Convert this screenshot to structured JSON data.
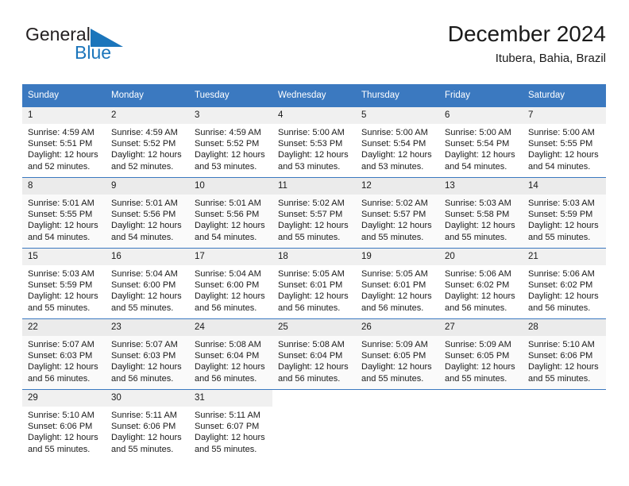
{
  "brand": {
    "name_part1": "General",
    "name_part2": "Blue",
    "logo_icon": "triangle-icon",
    "blue": "#1b75bb"
  },
  "header": {
    "title": "December 2024",
    "location": "Itubera, Bahia, Brazil",
    "header_bg": "#3b79c0"
  },
  "weekday_headers": [
    "Sunday",
    "Monday",
    "Tuesday",
    "Wednesday",
    "Thursday",
    "Friday",
    "Saturday"
  ],
  "labels": {
    "sunrise": "Sunrise:",
    "sunset": "Sunset:",
    "daylight": "Daylight:"
  },
  "weeks": [
    [
      {
        "day": "1",
        "sunrise": "Sunrise: 4:59 AM",
        "sunset": "Sunset: 5:51 PM",
        "daylight1": "Daylight: 12 hours",
        "daylight2": "and 52 minutes."
      },
      {
        "day": "2",
        "sunrise": "Sunrise: 4:59 AM",
        "sunset": "Sunset: 5:52 PM",
        "daylight1": "Daylight: 12 hours",
        "daylight2": "and 52 minutes."
      },
      {
        "day": "3",
        "sunrise": "Sunrise: 4:59 AM",
        "sunset": "Sunset: 5:52 PM",
        "daylight1": "Daylight: 12 hours",
        "daylight2": "and 53 minutes."
      },
      {
        "day": "4",
        "sunrise": "Sunrise: 5:00 AM",
        "sunset": "Sunset: 5:53 PM",
        "daylight1": "Daylight: 12 hours",
        "daylight2": "and 53 minutes."
      },
      {
        "day": "5",
        "sunrise": "Sunrise: 5:00 AM",
        "sunset": "Sunset: 5:54 PM",
        "daylight1": "Daylight: 12 hours",
        "daylight2": "and 53 minutes."
      },
      {
        "day": "6",
        "sunrise": "Sunrise: 5:00 AM",
        "sunset": "Sunset: 5:54 PM",
        "daylight1": "Daylight: 12 hours",
        "daylight2": "and 54 minutes."
      },
      {
        "day": "7",
        "sunrise": "Sunrise: 5:00 AM",
        "sunset": "Sunset: 5:55 PM",
        "daylight1": "Daylight: 12 hours",
        "daylight2": "and 54 minutes."
      }
    ],
    [
      {
        "day": "8",
        "sunrise": "Sunrise: 5:01 AM",
        "sunset": "Sunset: 5:55 PM",
        "daylight1": "Daylight: 12 hours",
        "daylight2": "and 54 minutes."
      },
      {
        "day": "9",
        "sunrise": "Sunrise: 5:01 AM",
        "sunset": "Sunset: 5:56 PM",
        "daylight1": "Daylight: 12 hours",
        "daylight2": "and 54 minutes."
      },
      {
        "day": "10",
        "sunrise": "Sunrise: 5:01 AM",
        "sunset": "Sunset: 5:56 PM",
        "daylight1": "Daylight: 12 hours",
        "daylight2": "and 54 minutes."
      },
      {
        "day": "11",
        "sunrise": "Sunrise: 5:02 AM",
        "sunset": "Sunset: 5:57 PM",
        "daylight1": "Daylight: 12 hours",
        "daylight2": "and 55 minutes."
      },
      {
        "day": "12",
        "sunrise": "Sunrise: 5:02 AM",
        "sunset": "Sunset: 5:57 PM",
        "daylight1": "Daylight: 12 hours",
        "daylight2": "and 55 minutes."
      },
      {
        "day": "13",
        "sunrise": "Sunrise: 5:03 AM",
        "sunset": "Sunset: 5:58 PM",
        "daylight1": "Daylight: 12 hours",
        "daylight2": "and 55 minutes."
      },
      {
        "day": "14",
        "sunrise": "Sunrise: 5:03 AM",
        "sunset": "Sunset: 5:59 PM",
        "daylight1": "Daylight: 12 hours",
        "daylight2": "and 55 minutes."
      }
    ],
    [
      {
        "day": "15",
        "sunrise": "Sunrise: 5:03 AM",
        "sunset": "Sunset: 5:59 PM",
        "daylight1": "Daylight: 12 hours",
        "daylight2": "and 55 minutes."
      },
      {
        "day": "16",
        "sunrise": "Sunrise: 5:04 AM",
        "sunset": "Sunset: 6:00 PM",
        "daylight1": "Daylight: 12 hours",
        "daylight2": "and 55 minutes."
      },
      {
        "day": "17",
        "sunrise": "Sunrise: 5:04 AM",
        "sunset": "Sunset: 6:00 PM",
        "daylight1": "Daylight: 12 hours",
        "daylight2": "and 56 minutes."
      },
      {
        "day": "18",
        "sunrise": "Sunrise: 5:05 AM",
        "sunset": "Sunset: 6:01 PM",
        "daylight1": "Daylight: 12 hours",
        "daylight2": "and 56 minutes."
      },
      {
        "day": "19",
        "sunrise": "Sunrise: 5:05 AM",
        "sunset": "Sunset: 6:01 PM",
        "daylight1": "Daylight: 12 hours",
        "daylight2": "and 56 minutes."
      },
      {
        "day": "20",
        "sunrise": "Sunrise: 5:06 AM",
        "sunset": "Sunset: 6:02 PM",
        "daylight1": "Daylight: 12 hours",
        "daylight2": "and 56 minutes."
      },
      {
        "day": "21",
        "sunrise": "Sunrise: 5:06 AM",
        "sunset": "Sunset: 6:02 PM",
        "daylight1": "Daylight: 12 hours",
        "daylight2": "and 56 minutes."
      }
    ],
    [
      {
        "day": "22",
        "sunrise": "Sunrise: 5:07 AM",
        "sunset": "Sunset: 6:03 PM",
        "daylight1": "Daylight: 12 hours",
        "daylight2": "and 56 minutes."
      },
      {
        "day": "23",
        "sunrise": "Sunrise: 5:07 AM",
        "sunset": "Sunset: 6:03 PM",
        "daylight1": "Daylight: 12 hours",
        "daylight2": "and 56 minutes."
      },
      {
        "day": "24",
        "sunrise": "Sunrise: 5:08 AM",
        "sunset": "Sunset: 6:04 PM",
        "daylight1": "Daylight: 12 hours",
        "daylight2": "and 56 minutes."
      },
      {
        "day": "25",
        "sunrise": "Sunrise: 5:08 AM",
        "sunset": "Sunset: 6:04 PM",
        "daylight1": "Daylight: 12 hours",
        "daylight2": "and 56 minutes."
      },
      {
        "day": "26",
        "sunrise": "Sunrise: 5:09 AM",
        "sunset": "Sunset: 6:05 PM",
        "daylight1": "Daylight: 12 hours",
        "daylight2": "and 55 minutes."
      },
      {
        "day": "27",
        "sunrise": "Sunrise: 5:09 AM",
        "sunset": "Sunset: 6:05 PM",
        "daylight1": "Daylight: 12 hours",
        "daylight2": "and 55 minutes."
      },
      {
        "day": "28",
        "sunrise": "Sunrise: 5:10 AM",
        "sunset": "Sunset: 6:06 PM",
        "daylight1": "Daylight: 12 hours",
        "daylight2": "and 55 minutes."
      }
    ],
    [
      {
        "day": "29",
        "sunrise": "Sunrise: 5:10 AM",
        "sunset": "Sunset: 6:06 PM",
        "daylight1": "Daylight: 12 hours",
        "daylight2": "and 55 minutes."
      },
      {
        "day": "30",
        "sunrise": "Sunrise: 5:11 AM",
        "sunset": "Sunset: 6:06 PM",
        "daylight1": "Daylight: 12 hours",
        "daylight2": "and 55 minutes."
      },
      {
        "day": "31",
        "sunrise": "Sunrise: 5:11 AM",
        "sunset": "Sunset: 6:07 PM",
        "daylight1": "Daylight: 12 hours",
        "daylight2": "and 55 minutes."
      },
      {
        "day": "",
        "sunrise": "",
        "sunset": "",
        "daylight1": "",
        "daylight2": ""
      },
      {
        "day": "",
        "sunrise": "",
        "sunset": "",
        "daylight1": "",
        "daylight2": ""
      },
      {
        "day": "",
        "sunrise": "",
        "sunset": "",
        "daylight1": "",
        "daylight2": ""
      },
      {
        "day": "",
        "sunrise": "",
        "sunset": "",
        "daylight1": "",
        "daylight2": ""
      }
    ]
  ]
}
